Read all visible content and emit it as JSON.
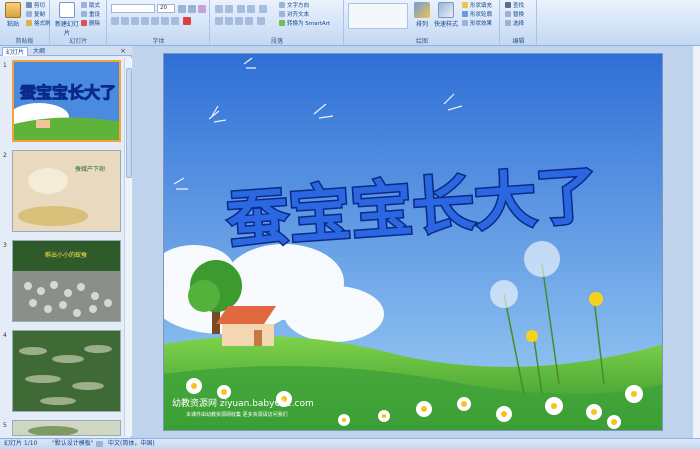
{
  "ribbon": {
    "groups": [
      {
        "label": "剪贴板",
        "items": [
          "粘贴",
          "剪切",
          "复制",
          "格式刷"
        ]
      },
      {
        "label": "幻灯片",
        "items": [
          "新建幻灯片",
          "版式",
          "重设",
          "删除"
        ]
      },
      {
        "label": "字体",
        "font_size": "20"
      },
      {
        "label": "段落",
        "items": [
          "文字方向",
          "对齐文本",
          "转换为 SmartArt"
        ]
      },
      {
        "label": "绘图",
        "items": [
          "排列",
          "快速样式",
          "形状填充",
          "形状轮廓",
          "形状效果"
        ]
      },
      {
        "label": "编辑",
        "items": [
          "查找",
          "替换",
          "选择"
        ]
      }
    ]
  },
  "pane": {
    "tabs": [
      "幻灯片",
      "大纲"
    ],
    "close": "×",
    "slides": [
      {
        "num": "1",
        "caption": ""
      },
      {
        "num": "2",
        "caption": "蚕蛾产下卵"
      },
      {
        "num": "3",
        "caption": "孵出小小的蚁蚕"
      },
      {
        "num": "4",
        "caption": ""
      },
      {
        "num": "5",
        "caption": ""
      }
    ]
  },
  "slide": {
    "title": "蚕宝宝长大了",
    "watermark": "幼教资源网 ziyuan.baby611.com",
    "watermark_sub": "本课件由幼教资源网收集 更多资源请访问我们"
  },
  "status": {
    "slide_info": "幻灯片 1/10",
    "theme": "\"默认设计模板\"",
    "language": "中文(简体，中国)"
  },
  "colors": {
    "accent": "#15428b",
    "sky": "#4a8be0",
    "grass": "#5fb33a",
    "selection": "#f4a23c"
  }
}
